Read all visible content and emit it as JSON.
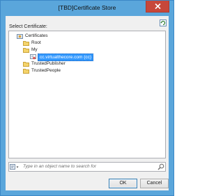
{
  "window": {
    "title": "[TBD]Certificate Store"
  },
  "dialog": {
    "select_label": "Select Certificate:",
    "tree": [
      {
        "label": "Certificates",
        "level": 0,
        "expanded": true,
        "icon": "certificate-store-icon"
      },
      {
        "label": "Root",
        "level": 1,
        "expanded": false,
        "icon": "folder-icon"
      },
      {
        "label": "My",
        "level": 1,
        "expanded": true,
        "icon": "folder-icon"
      },
      {
        "label": "cc.virtualthecore.com (cc)",
        "level": 2,
        "selected": true,
        "icon": "certificate-icon"
      },
      {
        "label": "TrustedPublisher",
        "level": 1,
        "expanded": false,
        "icon": "folder-icon"
      },
      {
        "label": "TrustedPeople",
        "level": 1,
        "expanded": false,
        "icon": "folder-icon"
      }
    ],
    "search": {
      "placeholder": "Type in an object name to search for"
    },
    "buttons": {
      "ok": "OK",
      "cancel": "Cancel"
    }
  },
  "colors": {
    "titlebar": "#5aa6db",
    "close": "#c7473a",
    "selection": "#3399ff",
    "client": "#f0f0f0"
  }
}
